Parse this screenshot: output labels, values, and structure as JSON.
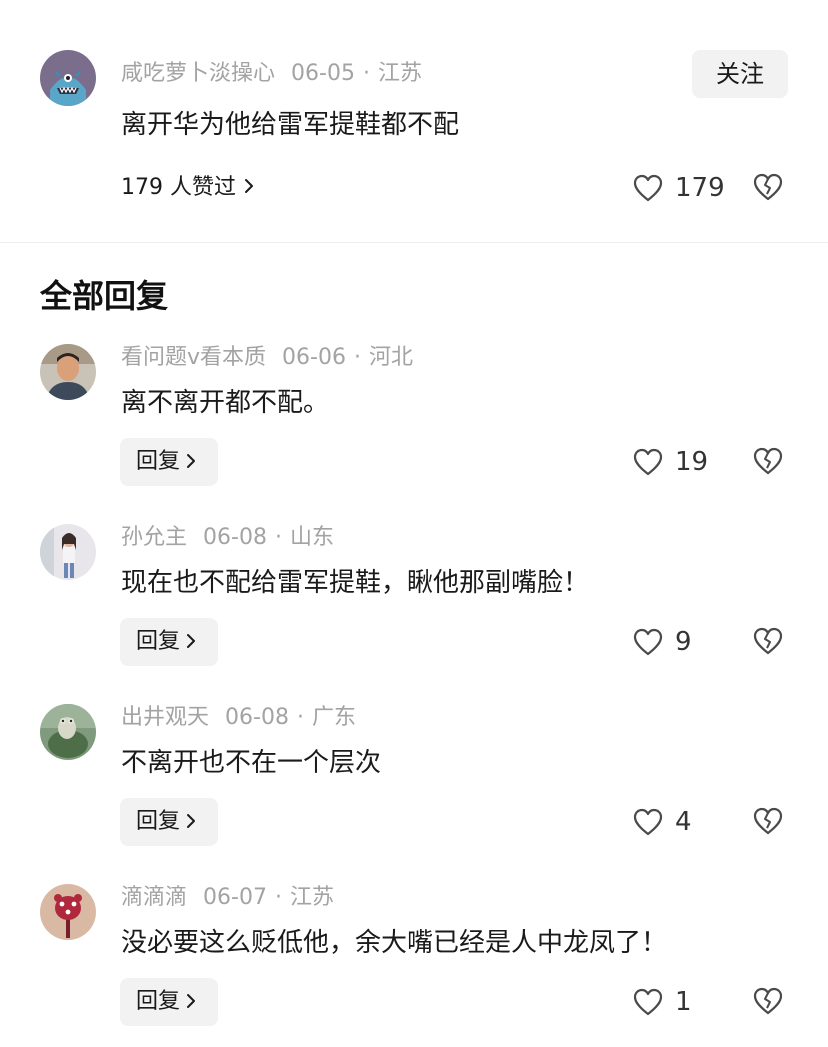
{
  "main_comment": {
    "author": "咸吃萝卜淡操心",
    "date": "06-05",
    "location": "江苏",
    "follow_label": "关注",
    "text": "离开华为他给雷军提鞋都不配",
    "likers_text": "179 人赞过",
    "like_count": "179"
  },
  "section_title": "全部回复",
  "replies": [
    {
      "author": "看问题v看本质",
      "date": "06-06",
      "location": "河北",
      "text": "离不离开都不配。",
      "reply_label": "回复",
      "like_count": "19"
    },
    {
      "author": "孙允主",
      "date": "06-08",
      "location": "山东",
      "text": "现在也不配给雷军提鞋，瞅他那副嘴脸！",
      "reply_label": "回复",
      "like_count": "9"
    },
    {
      "author": "出井观天",
      "date": "06-08",
      "location": "广东",
      "text": "不离开也不在一个层次",
      "reply_label": "回复",
      "like_count": "4"
    },
    {
      "author": "滴滴滴",
      "date": "06-07",
      "location": "江苏",
      "text": "没必要这么贬低他，余大嘴已经是人中龙凤了！",
      "reply_label": "回复",
      "like_count": "1"
    }
  ],
  "separator": "·",
  "colors": {
    "meta_text": "#a3a3a3",
    "body_text": "#1a1a1a",
    "button_bg": "#f2f2f2",
    "divider": "#eeeeee"
  },
  "icons": {
    "like": "heart-outline-icon",
    "dislike": "broken-heart-icon",
    "chevron": "chevron-right-icon"
  }
}
